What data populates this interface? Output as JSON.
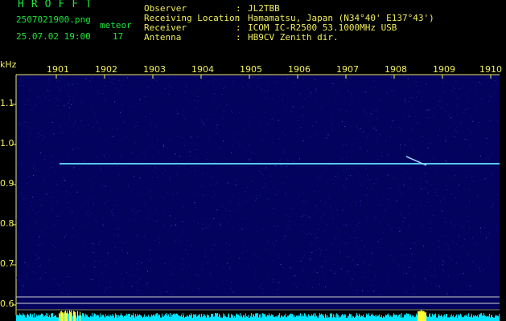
{
  "header": {
    "app_name": "HROFFT",
    "file_name": "2507021900.png",
    "date_time": "25.07.02 19:00",
    "meteor_label": "meteor",
    "meteor_count": "17"
  },
  "info": [
    {
      "label": "Observer",
      "value": "JL2TBB"
    },
    {
      "label": "Receiving Location",
      "value": "Hamamatsu, Japan (N34°40' E137°43')"
    },
    {
      "label": "Receiver",
      "value": "ICOM IC-R2500 53.1000MHz USB"
    },
    {
      "label": "Antenna",
      "value": "HB9CV Zenith dir."
    }
  ],
  "axis": {
    "y_unit": "kHz",
    "x_ticks": [
      "1901",
      "1902",
      "1903",
      "1904",
      "1905",
      "1906",
      "1907",
      "1908",
      "1909",
      "1910"
    ],
    "y_ticks": [
      "1.1",
      "1.0",
      "0.9",
      "0.8",
      "0.7",
      "0.6"
    ]
  },
  "colors": {
    "background": "#03035e",
    "carrier": "#57c8ff",
    "label": "#f0ee5a",
    "title": "#19e63a",
    "baseline": "#00e5ff"
  }
}
